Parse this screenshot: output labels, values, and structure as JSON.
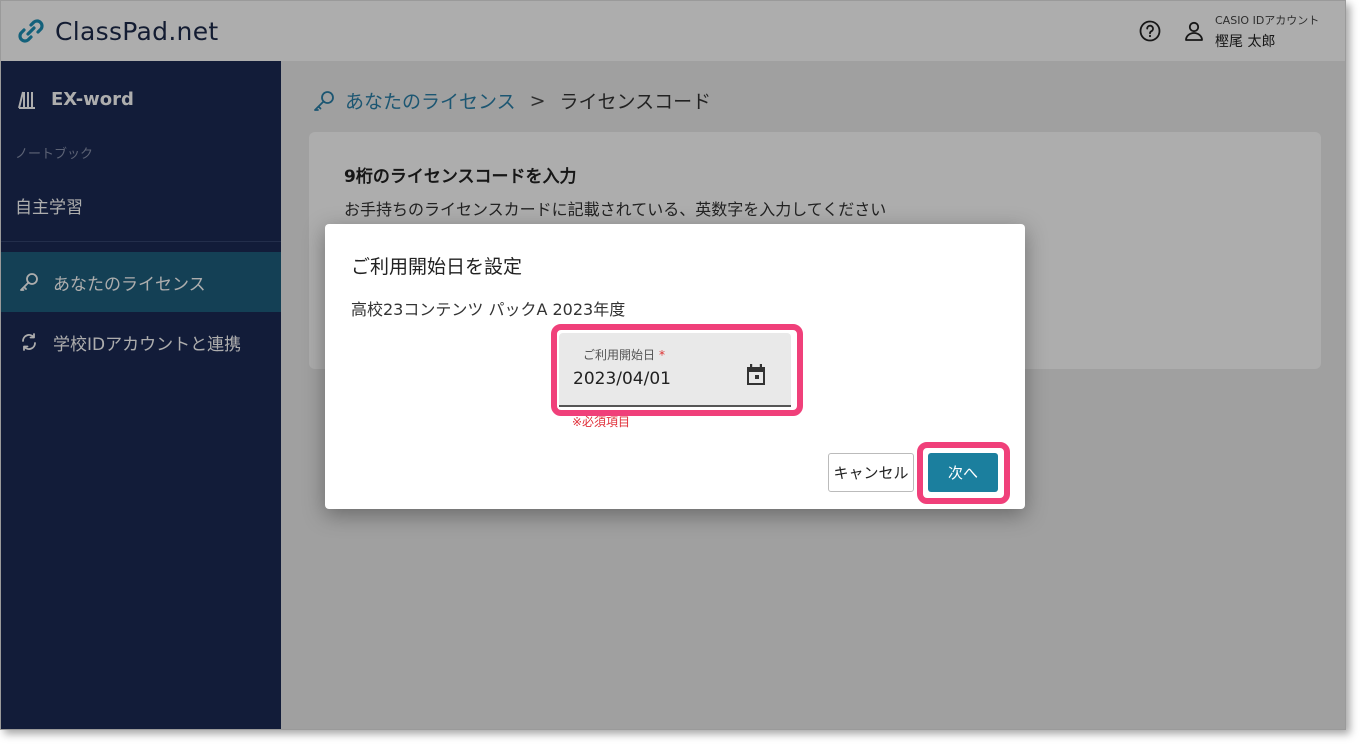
{
  "header": {
    "app_name": "ClassPad.net",
    "account_label": "CASIO IDアカウント",
    "account_name": "樫尾 太郎",
    "icons": {
      "logo": "link-logo-icon",
      "help": "help-circle-icon",
      "user": "user-icon"
    }
  },
  "sidebar": {
    "product": "EX-word",
    "section_label": "ノートブック",
    "self_study": "自主学習",
    "items": [
      {
        "label": "あなたのライセンス",
        "icon": "key-icon",
        "active": true
      },
      {
        "label": "学校IDアカウントと連携",
        "icon": "sync-icon",
        "active": false
      }
    ]
  },
  "breadcrumb": {
    "parent": "あなたのライセンス",
    "separator": ">",
    "current": "ライセンスコード"
  },
  "card": {
    "title": "9桁のライセンスコードを入力",
    "description": "お手持ちのライセンスカードに記載されている、英数字を入力してください"
  },
  "dialog": {
    "title": "ご利用開始日を設定",
    "product": "高校23コンテンツ パックA 2023年度",
    "date_field": {
      "label": "ご利用開始日",
      "required_mark": "*",
      "value": "2023/04/01"
    },
    "required_note": "※必須項目",
    "cancel_label": "キャンセル",
    "next_label": "次へ"
  },
  "colors": {
    "sidebar_bg": "#1b2a55",
    "sidebar_active": "#1e5f7e",
    "accent": "#1b7f9e",
    "highlight": "#f0407a",
    "error": "#e0303a"
  }
}
